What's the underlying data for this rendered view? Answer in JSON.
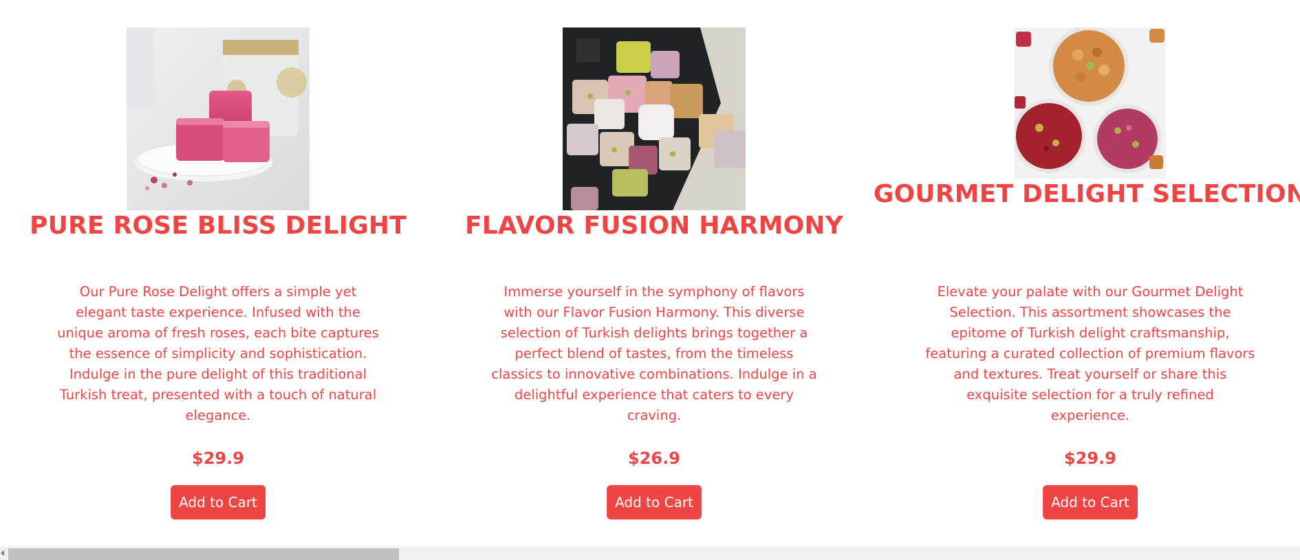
{
  "products": [
    {
      "title": "PURE ROSE BLISS DELIGHT",
      "description": "Our Pure Rose Delight offers a simple yet elegant taste experience. Infused with the unique aroma of fresh roses, each bite captures the essence of simplicity and sophistication. Indulge in the pure delight of this traditional Turkish treat, presented with a touch of natural elegance.",
      "price": "$29.9",
      "button_label": "Add to Cart"
    },
    {
      "title": "FLAVOR FUSION HARMONY",
      "description": "Immerse yourself in the symphony of flavors with our Flavor Fusion Harmony. This diverse selection of Turkish delights brings together a perfect blend of tastes, from the timeless classics to innovative combinations. Indulge in a delightful experience that caters to every craving.",
      "price": "$26.9",
      "button_label": "Add to Cart"
    },
    {
      "title": "GOURMET DELIGHT SELECTION",
      "description": "Elevate your palate with our Gourmet Delight Selection. This assortment showcases the epitome of Turkish delight craftsmanship, featuring a curated collection of premium flavors and textures. Treat yourself or share this exquisite selection for a truly refined experience.",
      "price": "$29.9",
      "button_label": "Add to Cart"
    }
  ],
  "colors": {
    "accent": "#ef4444",
    "button_text": "#ffffff",
    "background": "#ffffff",
    "scrollbar_track": "#f0f0f0",
    "scrollbar_thumb": "#c0c0c0"
  }
}
